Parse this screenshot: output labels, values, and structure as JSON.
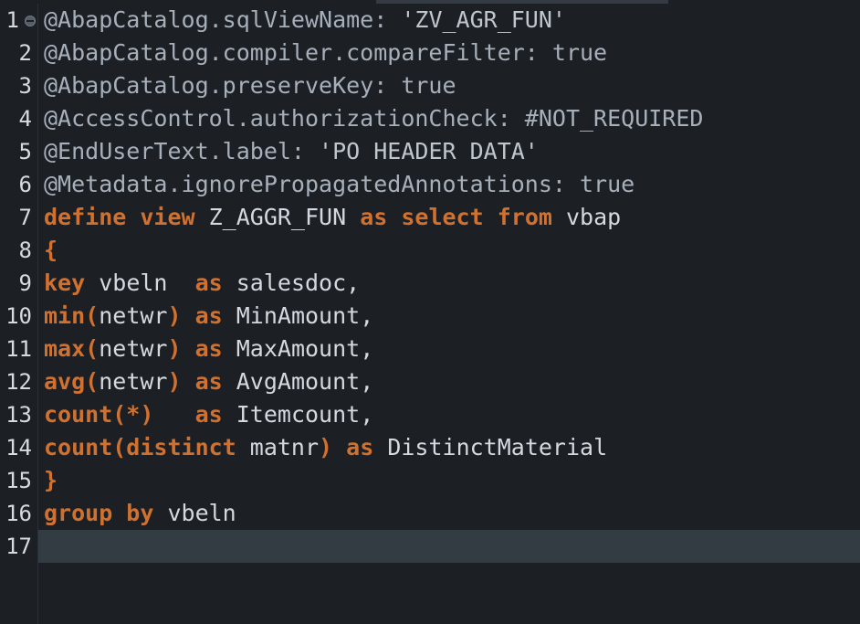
{
  "editor": {
    "name": "abap-cds-code-editor",
    "language": "ABAP CDS",
    "theme_colors": {
      "background": "#1c2025",
      "gutter_background": "#1c2025",
      "gutter_separator": "#2a3037",
      "line_number": "#d6dbe1",
      "active_line_highlight": "#333b43",
      "keyword": "#d1712f",
      "annotation": "#a7b0ba",
      "identifier": "#d4d9e0",
      "string": "#bfc6cd"
    },
    "total_lines": 17,
    "active_line": 17,
    "fold_marker_line": 1
  },
  "lines": [
    {
      "number": "1",
      "fold": true,
      "tokens": [
        {
          "t": "@AbapCatalog.sqlViewName: ",
          "c": "ann"
        },
        {
          "t": "'ZV_AGR_FUN'",
          "c": "str"
        }
      ]
    },
    {
      "number": "2",
      "fold": false,
      "tokens": [
        {
          "t": "@AbapCatalog.compiler.compareFilter: true",
          "c": "ann"
        }
      ]
    },
    {
      "number": "3",
      "fold": false,
      "tokens": [
        {
          "t": "@AbapCatalog.preserveKey: true",
          "c": "ann"
        }
      ]
    },
    {
      "number": "4",
      "fold": false,
      "tokens": [
        {
          "t": "@AccessControl.authorizationCheck: #NOT_REQUIRED",
          "c": "ann"
        }
      ]
    },
    {
      "number": "5",
      "fold": false,
      "tokens": [
        {
          "t": "@EndUserText.label: ",
          "c": "ann"
        },
        {
          "t": "'PO HEADER DATA'",
          "c": "str"
        }
      ]
    },
    {
      "number": "6",
      "fold": false,
      "tokens": [
        {
          "t": "@Metadata.ignorePropagatedAnnotations: true",
          "c": "ann"
        }
      ]
    },
    {
      "number": "7",
      "fold": false,
      "tokens": [
        {
          "t": "define view ",
          "c": "kw"
        },
        {
          "t": "Z_AGGR_FUN ",
          "c": "id"
        },
        {
          "t": "as select from ",
          "c": "kw"
        },
        {
          "t": "vbap",
          "c": "id"
        }
      ]
    },
    {
      "number": "8",
      "fold": false,
      "tokens": [
        {
          "t": "{",
          "c": "punct"
        }
      ]
    },
    {
      "number": "9",
      "fold": false,
      "tokens": [
        {
          "t": "key ",
          "c": "kw"
        },
        {
          "t": "vbeln  ",
          "c": "id"
        },
        {
          "t": "as ",
          "c": "kw"
        },
        {
          "t": "salesdoc,",
          "c": "id"
        }
      ]
    },
    {
      "number": "10",
      "fold": false,
      "tokens": [
        {
          "t": "min(",
          "c": "kw"
        },
        {
          "t": "netwr",
          "c": "id"
        },
        {
          "t": ") ",
          "c": "kw"
        },
        {
          "t": "as ",
          "c": "kw"
        },
        {
          "t": "MinAmount,",
          "c": "id"
        }
      ]
    },
    {
      "number": "11",
      "fold": false,
      "tokens": [
        {
          "t": "max(",
          "c": "kw"
        },
        {
          "t": "netwr",
          "c": "id"
        },
        {
          "t": ") ",
          "c": "kw"
        },
        {
          "t": "as ",
          "c": "kw"
        },
        {
          "t": "MaxAmount,",
          "c": "id"
        }
      ]
    },
    {
      "number": "12",
      "fold": false,
      "tokens": [
        {
          "t": "avg(",
          "c": "kw"
        },
        {
          "t": "netwr",
          "c": "id"
        },
        {
          "t": ") ",
          "c": "kw"
        },
        {
          "t": "as ",
          "c": "kw"
        },
        {
          "t": "AvgAmount,",
          "c": "id"
        }
      ]
    },
    {
      "number": "13",
      "fold": false,
      "tokens": [
        {
          "t": "count(*)   ",
          "c": "kw"
        },
        {
          "t": "as ",
          "c": "kw"
        },
        {
          "t": "Itemcount,",
          "c": "id"
        }
      ]
    },
    {
      "number": "14",
      "fold": false,
      "tokens": [
        {
          "t": "count(distinct ",
          "c": "kw"
        },
        {
          "t": "matnr",
          "c": "id"
        },
        {
          "t": ") ",
          "c": "kw"
        },
        {
          "t": "as ",
          "c": "kw"
        },
        {
          "t": "DistinctMaterial",
          "c": "id"
        }
      ]
    },
    {
      "number": "15",
      "fold": false,
      "tokens": [
        {
          "t": "}",
          "c": "punct"
        }
      ]
    },
    {
      "number": "16",
      "fold": false,
      "tokens": [
        {
          "t": "group by ",
          "c": "kw"
        },
        {
          "t": "vbeln",
          "c": "id"
        }
      ]
    },
    {
      "number": "17",
      "fold": false,
      "active": true,
      "tokens": []
    }
  ]
}
